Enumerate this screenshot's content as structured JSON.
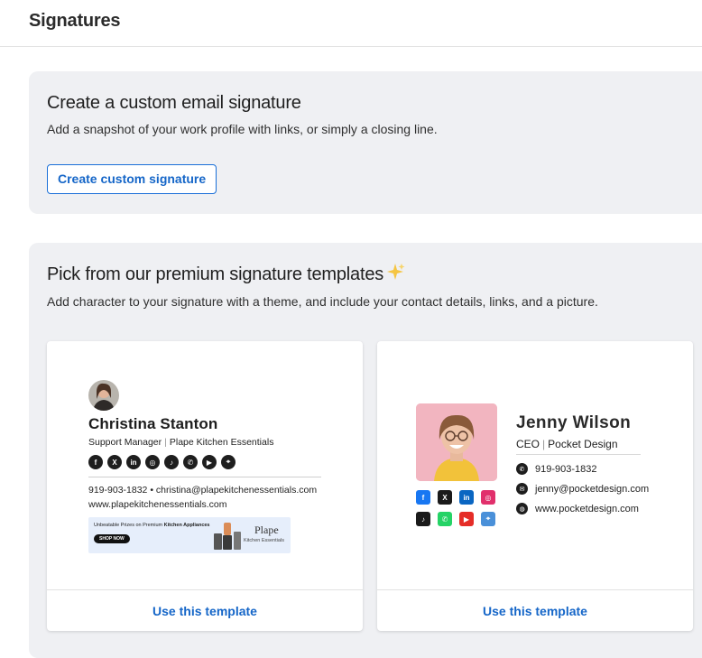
{
  "header": {
    "title": "Signatures"
  },
  "custom_section": {
    "title": "Create a custom email signature",
    "subtitle": "Add a snapshot of your work profile with links, or simply a closing line.",
    "button_label": "Create custom signature"
  },
  "premium_section": {
    "title": "Pick from our premium signature templates",
    "subtitle": "Add character to your signature with a theme, and include your contact details, links, and a picture.",
    "sparkle_icon": "sparkle-icon",
    "templates": [
      {
        "name": "Christina Stanton",
        "role": "Support Manager",
        "company": "Plape Kitchen Essentials",
        "socials": [
          "facebook",
          "x",
          "linkedin",
          "instagram",
          "tiktok",
          "whatsapp",
          "youtube",
          "location"
        ],
        "phone": "919-903-1832",
        "bullet": "•",
        "email": "christina@plapekitchenessentials.com",
        "website": "www.plapekitchenessentials.com",
        "banner": {
          "text_pre": "Unbeatable Prizes on Premium ",
          "text_bold": "Kitchen Appliances",
          "cta": "SHOP NOW",
          "brand": "Plape",
          "brand_sub": "Kitchen Essentials"
        },
        "action": "Use this template"
      },
      {
        "name": "Jenny Wilson",
        "role": "CEO",
        "company": "Pocket Design",
        "phone": "919-903-1832",
        "email": "jenny@pocketdesign.com",
        "website": "www.pocketdesign.com",
        "socials": [
          {
            "icon": "facebook",
            "glyph": "f",
            "color": "#1877f2"
          },
          {
            "icon": "x",
            "glyph": "X",
            "color": "#1a1a1a"
          },
          {
            "icon": "linkedin",
            "glyph": "in",
            "color": "#0a66c2"
          },
          {
            "icon": "instagram",
            "glyph": "◎",
            "color": "#e1306c"
          },
          {
            "icon": "tiktok",
            "glyph": "♪",
            "color": "#1a1a1a"
          },
          {
            "icon": "whatsapp",
            "glyph": "✆",
            "color": "#25d366"
          },
          {
            "icon": "youtube",
            "glyph": "▶",
            "color": "#e52d27"
          },
          {
            "icon": "location",
            "glyph": "⌖",
            "color": "#4a90d9"
          }
        ],
        "action": "Use this template"
      }
    ]
  },
  "colors": {
    "accent": "#1566c8",
    "panel_bg": "#eff0f3"
  }
}
